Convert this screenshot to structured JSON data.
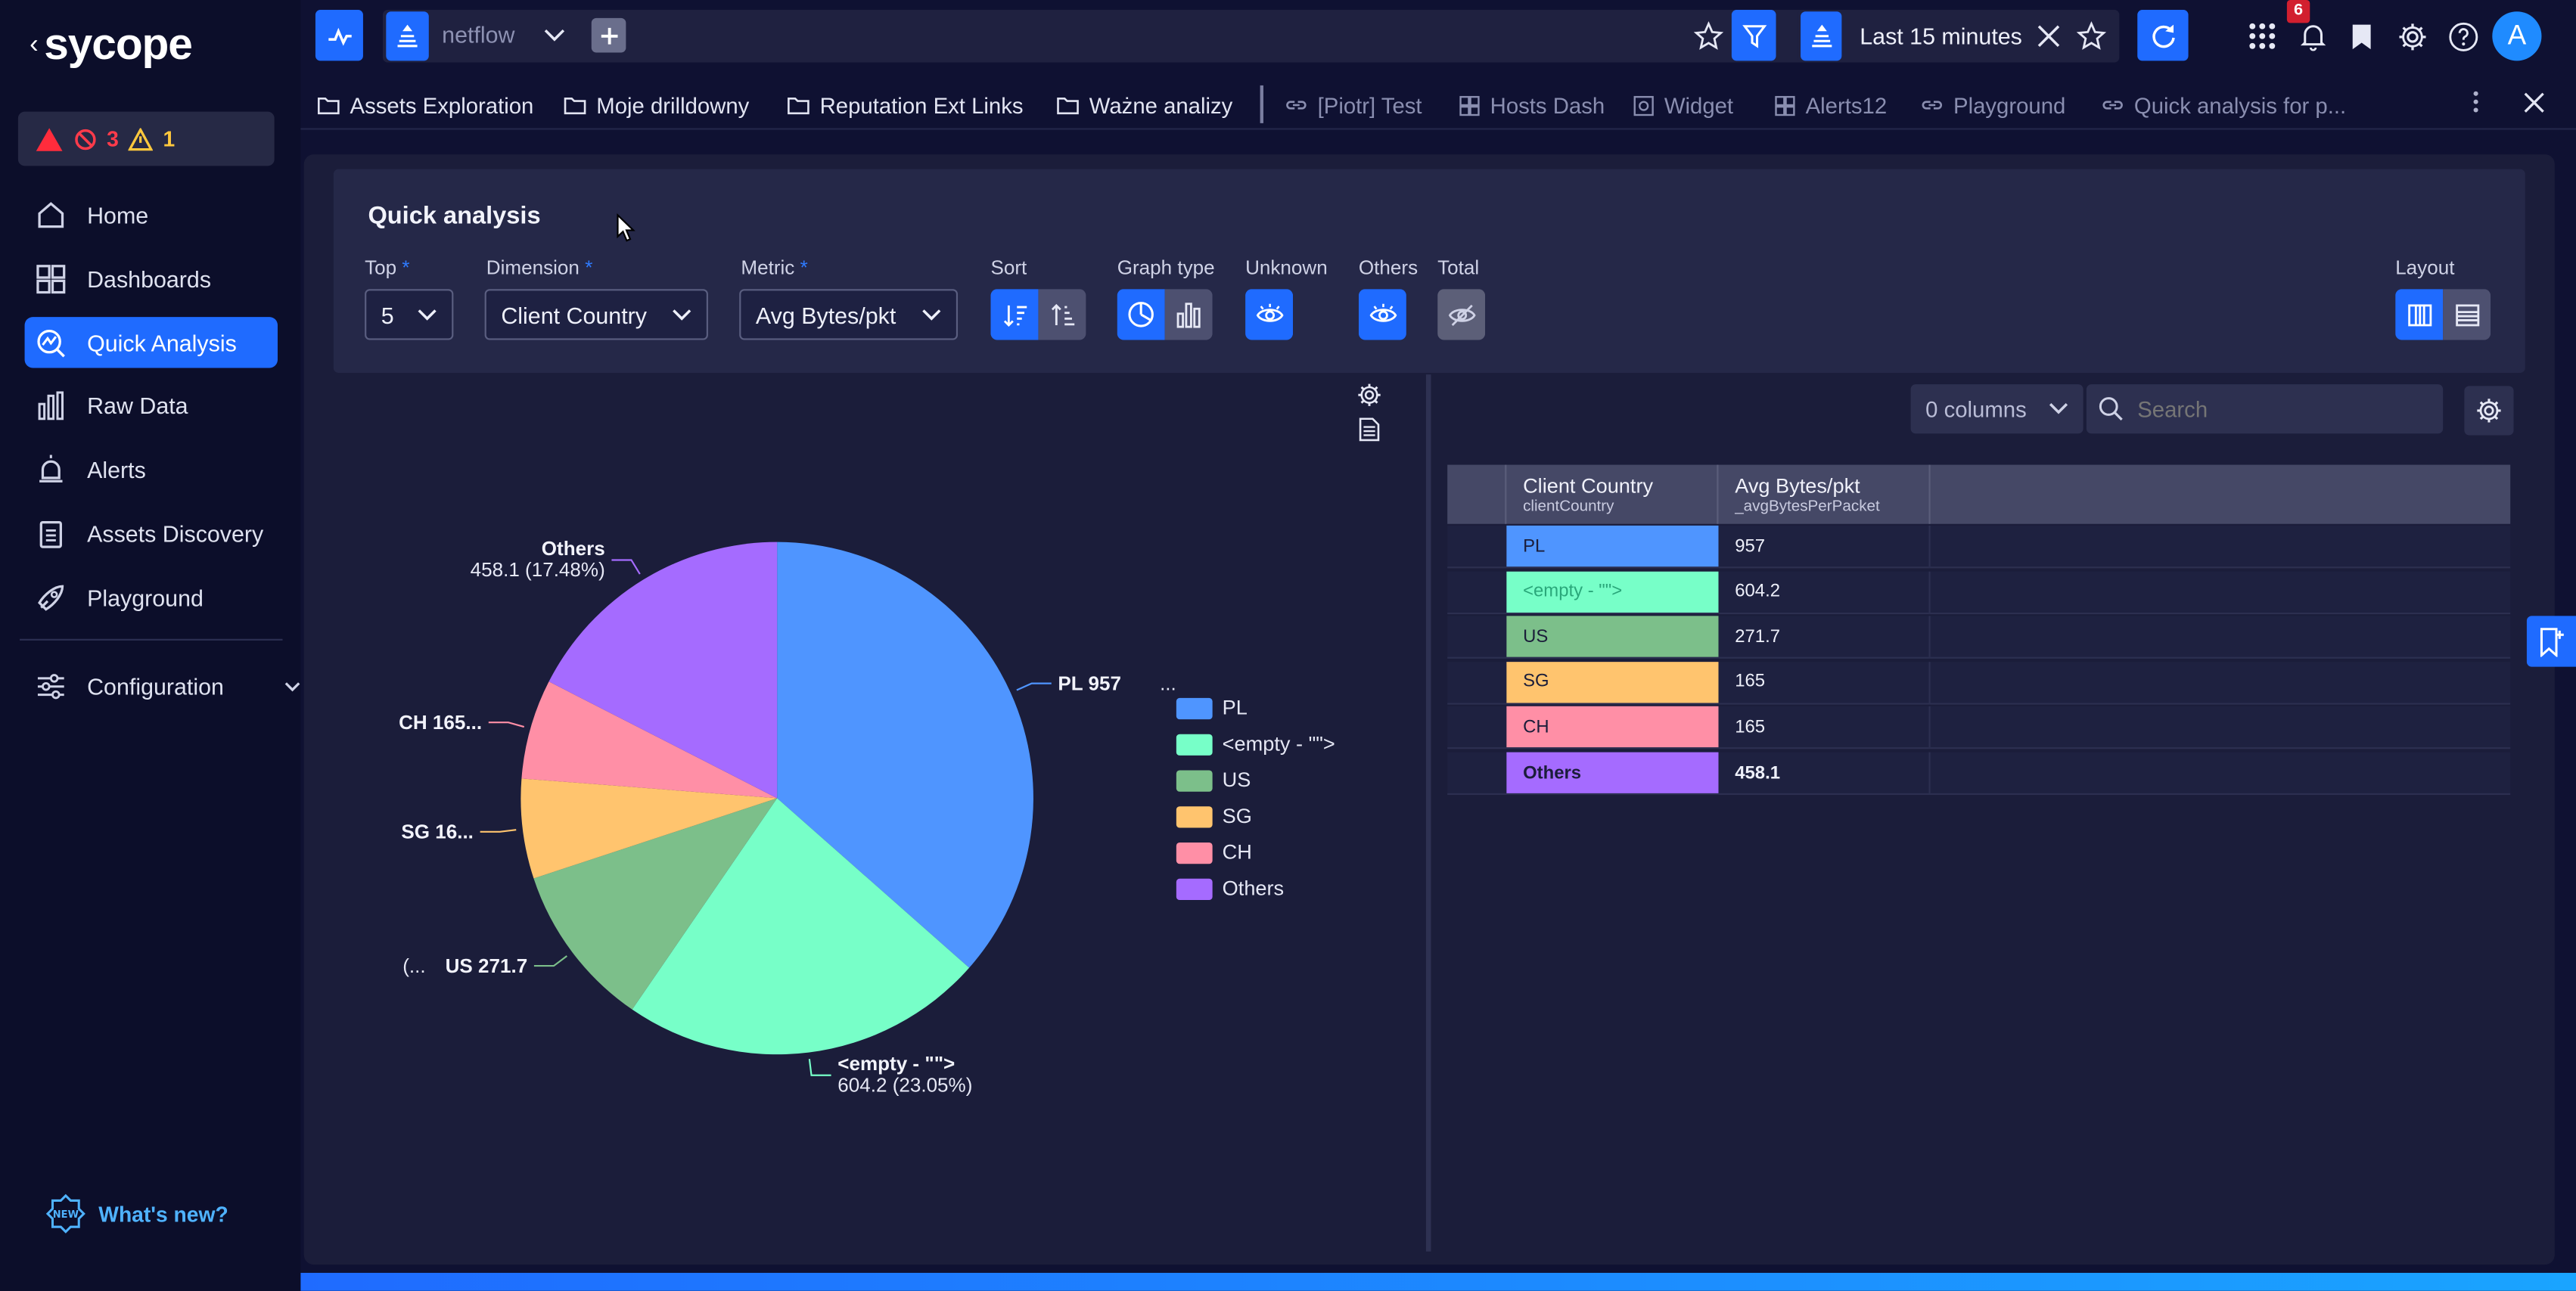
{
  "app": {
    "logo": "sycope",
    "back": "‹"
  },
  "alarms": {
    "errors": "3",
    "warnings": "1"
  },
  "sidebar": {
    "items": [
      {
        "label": "Home"
      },
      {
        "label": "Dashboards"
      },
      {
        "label": "Quick Analysis"
      },
      {
        "label": "Raw Data"
      },
      {
        "label": "Alerts"
      },
      {
        "label": "Assets Discovery"
      },
      {
        "label": "Playground"
      }
    ],
    "config": "Configuration",
    "whats_new": "What's new?"
  },
  "topbar": {
    "source": "netflow",
    "time_range": "Last 15 minutes",
    "notifications": "6",
    "avatar": "A"
  },
  "tabs": [
    {
      "label": "Assets Exploration"
    },
    {
      "label": "Moje drilldowny"
    },
    {
      "label": "Reputation Ext Links"
    },
    {
      "label": "Ważne analizy"
    },
    {
      "label": "[Piotr] Test"
    },
    {
      "label": "Hosts Dash"
    },
    {
      "label": "Widget"
    },
    {
      "label": "Alerts12"
    },
    {
      "label": "Playground"
    },
    {
      "label": "Quick analysis for p..."
    }
  ],
  "panel": {
    "title": "Quick analysis",
    "top_label": "Top",
    "top_value": "5",
    "dimension_label": "Dimension",
    "dimension_value": "Client Country",
    "metric_label": "Metric",
    "metric_value": "Avg Bytes/pkt",
    "sort_label": "Sort",
    "graph_label": "Graph type",
    "unknown_label": "Unknown",
    "others_label": "Others",
    "total_label": "Total",
    "layout_label": "Layout",
    "required_mark": "*"
  },
  "table_tools": {
    "columns": "0 columns",
    "search_placeholder": "Search"
  },
  "table": {
    "headers": [
      {
        "title": "Client Country",
        "sub": "clientCountry"
      },
      {
        "title": "Avg Bytes/pkt",
        "sub": "_avgBytesPerPacket"
      }
    ],
    "rows": [
      {
        "name": "PL",
        "value": "957",
        "color": "#4f95ff",
        "text": "#1b1d3a"
      },
      {
        "name": "<empty - \"\">",
        "value": "604.2",
        "color": "#77ffc8",
        "text": "#2aa77a"
      },
      {
        "name": "US",
        "value": "271.7",
        "color": "#7cbf8a",
        "text": "#1b1d3a"
      },
      {
        "name": "SG",
        "value": "165",
        "color": "#ffc46e",
        "text": "#1b1d3a"
      },
      {
        "name": "CH",
        "value": "165",
        "color": "#ff8fa6",
        "text": "#1b1d3a"
      },
      {
        "name": "Others",
        "value": "458.1",
        "color": "#a56bff",
        "text": "#1b1d3a"
      }
    ]
  },
  "chart_data": {
    "type": "pie",
    "slices": [
      {
        "name": "PL",
        "value": 957,
        "color": "#4f95ff",
        "label_main": "PL 957",
        "label_sub": "..."
      },
      {
        "name": "<empty - \"\">",
        "value": 604.2,
        "percent": 23.05,
        "color": "#77ffc8",
        "label_main": "<empty - \"\">",
        "label_sub": "604.2  (23.05%)"
      },
      {
        "name": "US",
        "value": 271.7,
        "color": "#7cbf8a",
        "label_main": "US 271.7",
        "label_sub": "(..."
      },
      {
        "name": "SG",
        "value": 165,
        "color": "#ffc46e",
        "label_main": "SG 16...",
        "label_sub": ""
      },
      {
        "name": "CH",
        "value": 165,
        "color": "#ff8fa6",
        "label_main": "CH 165...",
        "label_sub": ""
      },
      {
        "name": "Others",
        "value": 458.1,
        "percent": 17.48,
        "color": "#a56bff",
        "label_main": "Others",
        "label_sub": "458.1  (17.48%)"
      }
    ],
    "legend": [
      "PL",
      "<empty - \"\">",
      "US",
      "SG",
      "CH",
      "Others"
    ],
    "legend_placement": "right"
  }
}
